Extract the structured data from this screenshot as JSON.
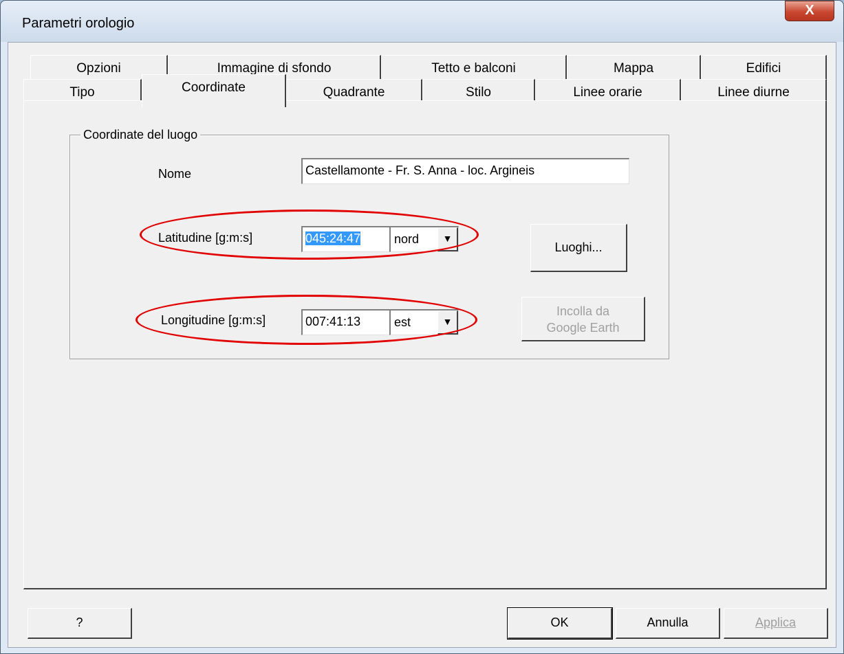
{
  "window": {
    "title": "Parametri orologio",
    "close_glyph": "X"
  },
  "tabs_back": [
    "Opzioni",
    "Immagine di sfondo",
    "Tetto e balconi",
    "Mappa",
    "Edifici"
  ],
  "tabs_front": [
    "Tipo",
    "Coordinate",
    "Quadrante",
    "Stilo",
    "Linee orarie",
    "Linee diurne"
  ],
  "selected_tab": "Coordinate",
  "group": {
    "title": "Coordinate del luogo",
    "name_label": "Nome",
    "name_value": "Castellamonte - Fr. S. Anna - loc. Argineis",
    "lat_label": "Latitudine [g:m:s]",
    "lat_value": "045:24:47",
    "lat_dir": "nord",
    "lon_label": "Longitudine [g:m:s]",
    "lon_value": "007:41:13",
    "lon_dir": "est",
    "luoghi_button": "Luoghi...",
    "paste_line1": "Incolla da",
    "paste_line2": "Google Earth"
  },
  "footer": {
    "help": "?",
    "ok": "OK",
    "cancel": "Annulla",
    "apply": "Applica"
  },
  "icons": {
    "dropdown": "chevron-down-icon",
    "close": "close-icon"
  },
  "colors": {
    "highlight": "#3399ff",
    "annotation": "#e20000"
  }
}
